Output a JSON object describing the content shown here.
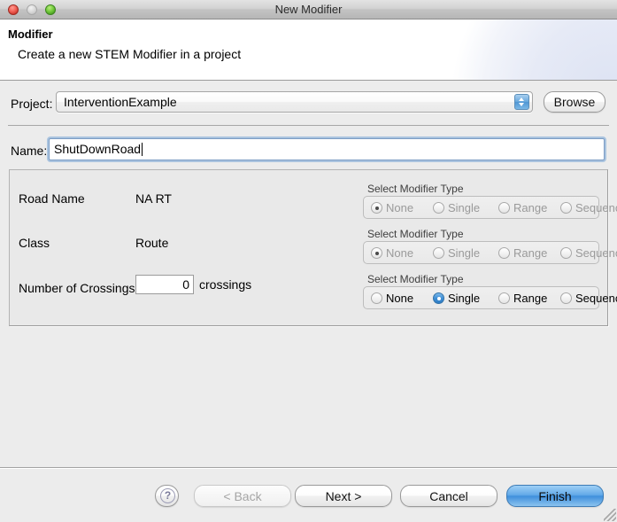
{
  "window": {
    "title": "New Modifier",
    "traffic_lights": [
      "close",
      "minimize",
      "zoom"
    ]
  },
  "header": {
    "title": "Modifier",
    "subtitle": "Create a new STEM Modifier in a project"
  },
  "project": {
    "label": "Project:",
    "value": "InterventionExample",
    "browse_label": "Browse"
  },
  "name": {
    "label": "Name:",
    "value": "ShutDownRoad"
  },
  "properties": {
    "rows": [
      {
        "name": "Road Name",
        "value": "NA RT"
      },
      {
        "name": "Class",
        "value": "Route"
      },
      {
        "name": "Number of Crossings",
        "value": "0",
        "unit": "crossings"
      }
    ]
  },
  "modifier_groups": [
    {
      "legend": "Select Modifier Type",
      "enabled": false,
      "selected": "None",
      "options": [
        "None",
        "Single",
        "Range",
        "Sequence"
      ]
    },
    {
      "legend": "Select Modifier Type",
      "enabled": false,
      "selected": "None",
      "options": [
        "None",
        "Single",
        "Range",
        "Sequence"
      ]
    },
    {
      "legend": "Select Modifier Type",
      "enabled": true,
      "selected": "Single",
      "options": [
        "None",
        "Single",
        "Range",
        "Sequence"
      ]
    }
  ],
  "buttons": {
    "help": "?",
    "back": "< Back",
    "next": "Next >",
    "cancel": "Cancel",
    "finish": "Finish"
  },
  "colors": {
    "accent_blue": "#3f8fdc",
    "window_bg": "#ececec",
    "panel_bg": "#e9e9e9",
    "disabled_text": "#9a9a9a"
  }
}
